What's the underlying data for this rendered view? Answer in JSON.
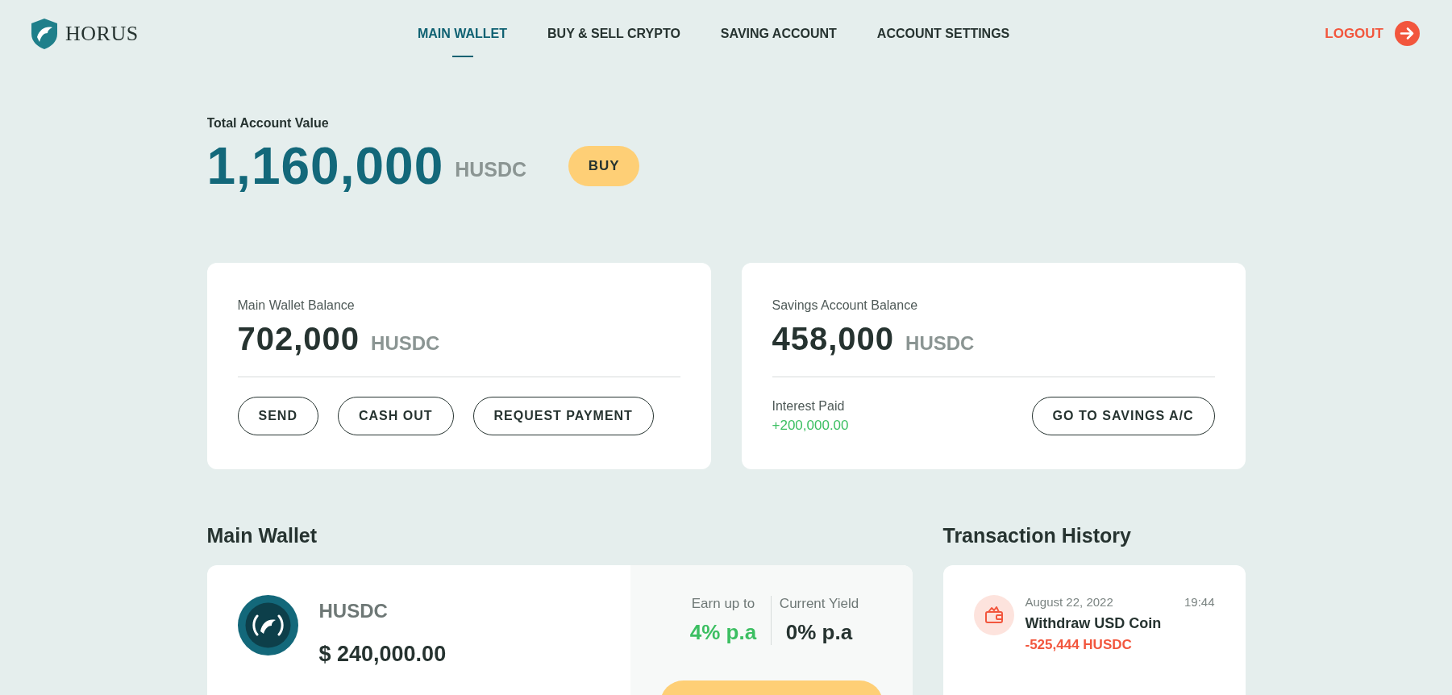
{
  "brand": {
    "name": "HORUS"
  },
  "nav": [
    {
      "label": "MAIN WALLET",
      "selected": true
    },
    {
      "label": "BUY & SELL CRYPTO",
      "selected": false
    },
    {
      "label": "SAVING ACCOUNT",
      "selected": false
    },
    {
      "label": "ACCOUNT SETTINGS",
      "selected": false
    }
  ],
  "logout": {
    "label": "LOGOUT"
  },
  "total": {
    "label": "Total Account Value",
    "value": "1,160,000",
    "unit": "HUSDC",
    "button": "BUY"
  },
  "balances": [
    {
      "kind": "wallet",
      "label": "Main Wallet Balance",
      "value": "702,000",
      "unit": "HUSDC",
      "buttons": [
        "SEND",
        "CASH OUT",
        "REQUEST PAYMENT"
      ]
    },
    {
      "kind": "savings",
      "label": "Savings Account Balance",
      "value": "458,000",
      "unit": "HUSDC",
      "interest_label": "Interest Paid",
      "interest_value": "+200,000.00",
      "buttons": [
        "GO TO SAVINGS A/C"
      ]
    }
  ],
  "main_wallet": {
    "title": "Main Wallet",
    "coin": {
      "name": "HUSDC",
      "amount": "$ 240,000.00"
    },
    "stats": [
      {
        "kind": "earn",
        "label": "Earn up to",
        "value": "4% p.a"
      },
      {
        "kind": "yield",
        "label": "Current Yield",
        "value": "0% p.a"
      }
    ]
  },
  "transactions": {
    "title": "Transaction History",
    "items": [
      {
        "date": "August 22, 2022",
        "time": "19:44",
        "title": "Withdraw USD Coin",
        "amount": "-525,444 HUSDC"
      }
    ]
  }
}
